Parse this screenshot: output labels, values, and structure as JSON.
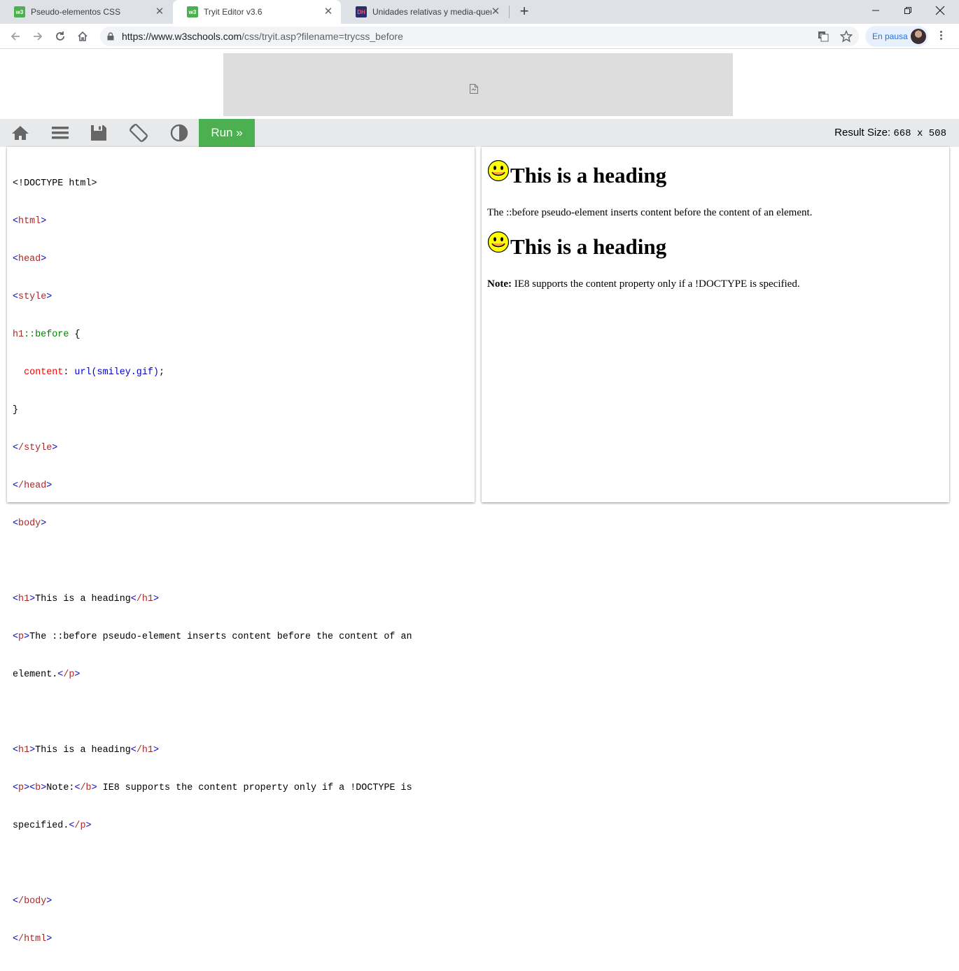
{
  "browser": {
    "tabs": [
      {
        "title": "Pseudo-elementos CSS",
        "favicon": "w3schools-icon",
        "favicon_text": "w3",
        "active": false
      },
      {
        "title": "Tryit Editor v3.6",
        "favicon": "w3schools-icon",
        "favicon_text": "w3",
        "active": true
      },
      {
        "title": "Unidades relativas y media-queri",
        "favicon": "dh-icon",
        "favicon_text": "DH",
        "active": false
      }
    ],
    "new_tab": "+",
    "url_host": "https://www.w3schools.com",
    "url_path": "/css/tryit.asp?filename=trycss_before",
    "profile_label": "En pausa"
  },
  "editor": {
    "run_label": "Run »",
    "result_size_label": "Result Size:",
    "result_size_value": "668 x 508",
    "toolbar_icons": [
      "home-icon",
      "menu-icon",
      "save-icon",
      "rotate-icon",
      "contrast-icon"
    ]
  },
  "code": {
    "l1": "<!DOCTYPE html>",
    "l2_tag": "html",
    "l3_tag": "head",
    "l4_tag": "style",
    "l5_sel": "h1",
    "l5_pseudo": "::before",
    "l5_brace": " {",
    "l6_prop": "content",
    "l6_val": "url(smiley.gif)",
    "l6_end": ";",
    "l7": "}",
    "l8_tag": "/style",
    "l9_tag": "/head",
    "l10_tag": "body",
    "h1_tag": "h1",
    "h1_text": "This is a heading",
    "h1_close": "/h1",
    "p_tag": "p",
    "p_text_a": "The ::before pseudo-element inserts content before the content of an",
    "p_text_b": "element.",
    "p_close": "/p",
    "b_tag": "b",
    "b_text": "Note:",
    "b_close": "/b",
    "p2_text_a": " IE8 supports the content property only if a !DOCTYPE is",
    "p2_text_b": "specified.",
    "body_close": "/body",
    "html_close": "/html"
  },
  "result": {
    "heading1": "This is a heading",
    "paragraph1": "The ::before pseudo-element inserts content before the content of an element.",
    "heading2": "This is a heading",
    "note_label": "Note:",
    "note_text": " IE8 supports the content property only if a !DOCTYPE is specified."
  },
  "colors": {
    "tab_strip": "#dee1e6",
    "run_button": "#4caf50",
    "editor_toolbar": "#e7e9eb",
    "tag_name": "#a52a2a",
    "bracket": "#0000cd",
    "pseudo": "#008000",
    "property": "#ff0000"
  }
}
